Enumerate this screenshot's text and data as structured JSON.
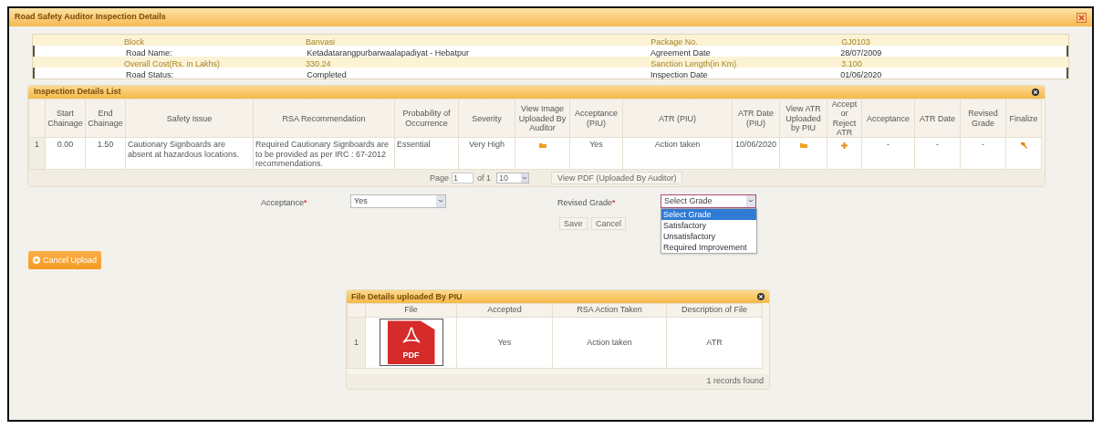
{
  "window": {
    "title": "Road Safety Auditor Inspection Details"
  },
  "info_rows": [
    {
      "highlighted": true,
      "cells": [
        "Block",
        "Banvasi",
        "Package No.",
        "GJ0103"
      ]
    },
    {
      "highlighted": false,
      "cells": [
        "Road Name:",
        "Ketadatarangpurbarwaalapadiyat - Hebatpur",
        "Agreement Date",
        "28/07/2009"
      ]
    },
    {
      "highlighted": true,
      "cells": [
        "Overall Cost(Rs. in Lakhs)",
        "330.24",
        "Sanction Length(in Km)",
        "3.100"
      ]
    },
    {
      "highlighted": false,
      "cells": [
        "Road Status:",
        "Completed",
        "Inspection Date",
        "01/06/2020"
      ]
    }
  ],
  "inspection_list": {
    "title": "Inspection Details List",
    "columns": [
      "",
      "Start Chainage",
      "End Chainage",
      "Safety Issue",
      "RSA Recommendation",
      "Probability of Occurrence",
      "Severity",
      "View Image Uploaded By Auditor",
      "Acceptance (PIU)",
      "ATR (PIU)",
      "ATR Date (PIU)",
      "View ATR Uploaded by PIU",
      "Accept or Reject ATR",
      "Acceptance",
      "ATR Date",
      "Revised Grade",
      "Finalize"
    ],
    "rows": [
      [
        {
          "kind": "text",
          "text": "1"
        },
        {
          "kind": "text",
          "text": "0.00"
        },
        {
          "kind": "text",
          "text": "1.50"
        },
        {
          "kind": "text",
          "text": "Cautionary Signboards are absent at hazardous locations."
        },
        {
          "kind": "text",
          "text": "Required Cautionary Signboards are to be provided as per IRC : 67-2012 recommendations."
        },
        {
          "kind": "text",
          "text": "Essential"
        },
        {
          "kind": "text",
          "text": "Very High"
        },
        {
          "kind": "image_icon"
        },
        {
          "kind": "text",
          "text": "Yes"
        },
        {
          "kind": "text",
          "text": "Action taken"
        },
        {
          "kind": "text",
          "text": "10/06/2020"
        },
        {
          "kind": "image_icon"
        },
        {
          "kind": "plus_icon"
        },
        {
          "kind": "text",
          "text": "-"
        },
        {
          "kind": "text",
          "text": "-"
        },
        {
          "kind": "text",
          "text": "-"
        },
        {
          "kind": "finalize_icon"
        }
      ]
    ],
    "pager": {
      "page_label": "Page",
      "page": "1",
      "of": "of 1",
      "page_size": "10"
    },
    "view_pdf_button": "View PDF (Uploaded By Auditor)"
  },
  "form": {
    "acceptance": {
      "label": "Acceptance",
      "required_mark": "*",
      "value": "Yes"
    },
    "revised_grade": {
      "label": "Revised Grade",
      "required_mark": "*",
      "value": "Select Grade",
      "expanded": true,
      "options": [
        {
          "text": "Select Grade",
          "selected": true
        },
        {
          "text": "Satisfactory",
          "selected": false
        },
        {
          "text": "Unsatisfactory",
          "selected": false
        },
        {
          "text": "Required Improvement",
          "selected": false
        }
      ]
    },
    "buttons": [
      "Save",
      "Cancel"
    ]
  },
  "cancel_upload_button": "Cancel Upload",
  "file_details": {
    "title": "File Details uploaded By PIU",
    "columns": [
      "",
      "File",
      "Accepted",
      "RSA Action Taken",
      "Description of File"
    ],
    "rows": [
      {
        "number": "1",
        "file_label": "PDF",
        "accepted": "Yes",
        "action": "Action taken",
        "description": "ATR"
      }
    ],
    "footer": "1 records found"
  }
}
